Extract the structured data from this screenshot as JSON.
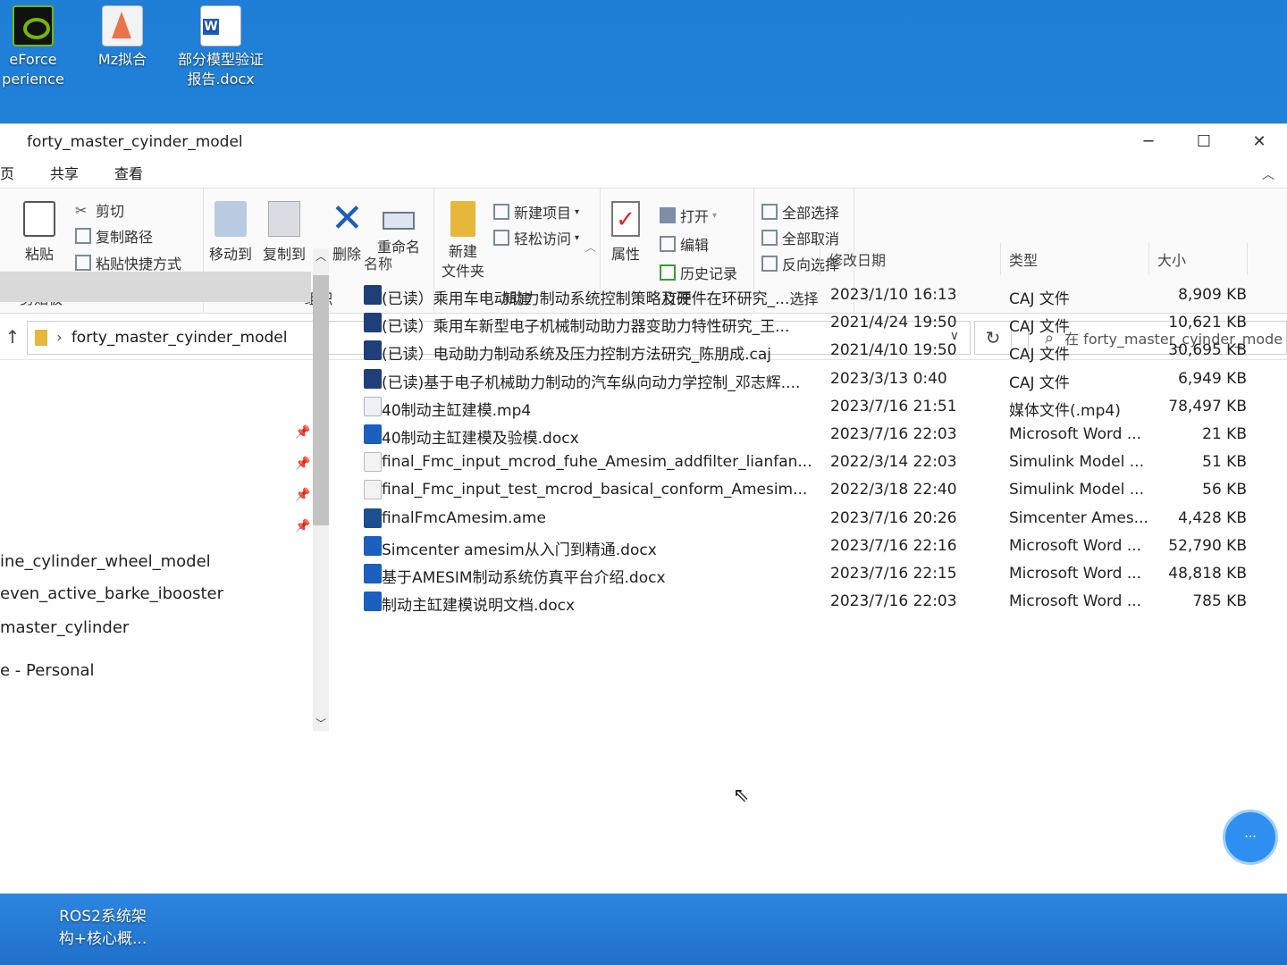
{
  "desktop": {
    "icons": [
      {
        "label": "eForce\nperience"
      },
      {
        "label": "Mz拟合"
      },
      {
        "label": "部分模型验证\n报告.docx"
      }
    ],
    "bottom_item": "ROS2系统架\n构+核心概..."
  },
  "window": {
    "title": "forty_master_cyinder_model",
    "controls": {
      "minimize": "─",
      "maximize": "☐",
      "close": "✕"
    }
  },
  "ribbon": {
    "tabs": [
      "页",
      "共享",
      "查看"
    ],
    "clipboard": {
      "label": "剪贴板",
      "paste": "粘贴",
      "cut": "剪切",
      "copy_path": "复制路径",
      "paste_shortcut": "粘贴快捷方式"
    },
    "organize": {
      "label": "组织",
      "move_to": "移动到",
      "copy_to": "复制到",
      "delete": "删除",
      "rename": "重命名"
    },
    "new": {
      "label": "新建",
      "new_folder_line1": "新建",
      "new_folder_line2": "文件夹",
      "new_item": "新建项目",
      "easy_access": "轻松访问"
    },
    "open": {
      "label": "打开",
      "properties": "属性",
      "open": "打开",
      "edit": "编辑",
      "history": "历史记录"
    },
    "select": {
      "label": "选择",
      "select_all": "全部选择",
      "select_none": "全部取消",
      "invert": "反向选择"
    }
  },
  "address": {
    "path": "forty_master_cyinder_model",
    "search_placeholder": "在 forty_master_cyinder_mode"
  },
  "nav": {
    "items": [
      "ine_cylinder_wheel_model",
      "even_active_barke_ibooster",
      "master_cylinder",
      "e - Personal"
    ]
  },
  "columns": {
    "name": "名称",
    "date": "修改日期",
    "type": "类型",
    "size": "大小"
  },
  "files": [
    {
      "icon": "caj",
      "name": "(已读）乘用车电动助力制动系统控制策略及硬件在环研究_...",
      "date": "2023/1/10 16:13",
      "type": "CAJ 文件",
      "size": "8,909 KB"
    },
    {
      "icon": "caj",
      "name": "(已读）乘用车新型电子机械制动助力器变助力特性研究_王...",
      "date": "2021/4/24 19:50",
      "type": "CAJ 文件",
      "size": "10,621 KB"
    },
    {
      "icon": "caj",
      "name": "(已读）电动助力制动系统及压力控制方法研究_陈朋成.caj",
      "date": "2021/4/10 19:50",
      "type": "CAJ 文件",
      "size": "30,695 KB"
    },
    {
      "icon": "caj",
      "name": "(已读)基于电子机械助力制动的汽车纵向动力学控制_邓志辉....",
      "date": "2023/3/13 0:40",
      "type": "CAJ 文件",
      "size": "6,949 KB"
    },
    {
      "icon": "mp4",
      "name": "40制动主缸建模.mp4",
      "date": "2023/7/16 21:51",
      "type": "媒体文件(.mp4)",
      "size": "78,497 KB"
    },
    {
      "icon": "word",
      "name": "40制动主缸建模及验模.docx",
      "date": "2023/7/16 22:03",
      "type": "Microsoft Word ...",
      "size": "21 KB"
    },
    {
      "icon": "slx",
      "name": "final_Fmc_input_mcrod_fuhe_Amesim_addfilter_lianfan...",
      "date": "2022/3/14 22:03",
      "type": "Simulink Model ...",
      "size": "51 KB"
    },
    {
      "icon": "slx",
      "name": "final_Fmc_input_test_mcrod_basical_conform_Amesim...",
      "date": "2022/3/18 22:40",
      "type": "Simulink Model ...",
      "size": "56 KB"
    },
    {
      "icon": "ame",
      "name": "finalFmcAmesim.ame",
      "date": "2023/7/16 20:26",
      "type": "Simcenter Ames...",
      "size": "4,428 KB"
    },
    {
      "icon": "word",
      "name": "Simcenter amesim从入门到精通.docx",
      "date": "2023/7/16 22:16",
      "type": "Microsoft Word ...",
      "size": "52,790 KB"
    },
    {
      "icon": "word",
      "name": "基于AMESIM制动系统仿真平台介绍.docx",
      "date": "2023/7/16 22:15",
      "type": "Microsoft Word ...",
      "size": "48,818 KB"
    },
    {
      "icon": "word",
      "name": "制动主缸建模说明文档.docx",
      "date": "2023/7/16 22:03",
      "type": "Microsoft Word ...",
      "size": "785 KB"
    }
  ]
}
